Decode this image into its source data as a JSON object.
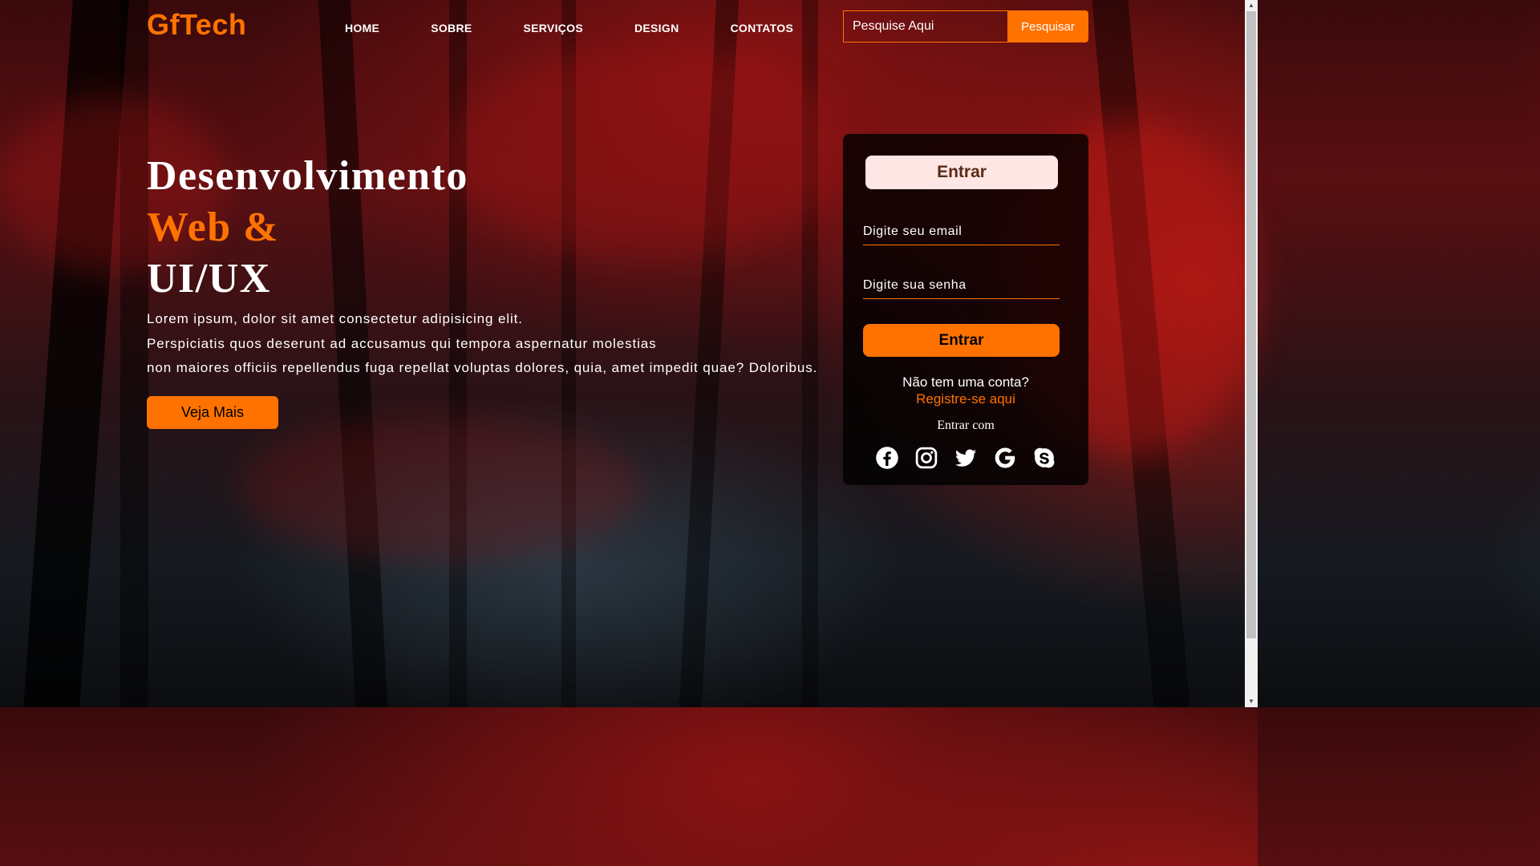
{
  "nav": {
    "logo": "GfTech",
    "items": [
      {
        "label": "HOME"
      },
      {
        "label": "SOBRE"
      },
      {
        "label": "SERVIÇOS"
      },
      {
        "label": "DESIGN"
      },
      {
        "label": "CONTATOS"
      }
    ],
    "search": {
      "placeholder": "Pesquise Aqui",
      "button_label": "Pesquisar"
    }
  },
  "hero": {
    "title_line1": "Desenvolvimento",
    "title_line2": "Web &",
    "title_line3": "UI/UX",
    "paragraph_lines": [
      "Lorem ipsum, dolor sit amet consectetur adipisicing elit.",
      "Perspiciatis quos deserunt ad accusamus qui tempora aspernatur molestias",
      "non maiores officiis repellendus fuga repellat voluptas dolores, quia, amet impedit quae? Doloribus."
    ],
    "cta_label": "Veja Mais"
  },
  "login": {
    "title": "Entrar",
    "email_placeholder": "Digite seu email",
    "password_placeholder": "Digite sua senha",
    "submit_label": "Entrar",
    "no_account_text": "Não tem uma conta?",
    "register_link": "Registre-se aqui",
    "login_with_text": "Entrar com",
    "social_icons": [
      "facebook-icon",
      "instagram-icon",
      "twitter-icon",
      "google-icon",
      "skype-icon"
    ]
  },
  "colors": {
    "accent": "#ff7200",
    "form_background": "#000000",
    "title_pill": "#fde6e4"
  }
}
